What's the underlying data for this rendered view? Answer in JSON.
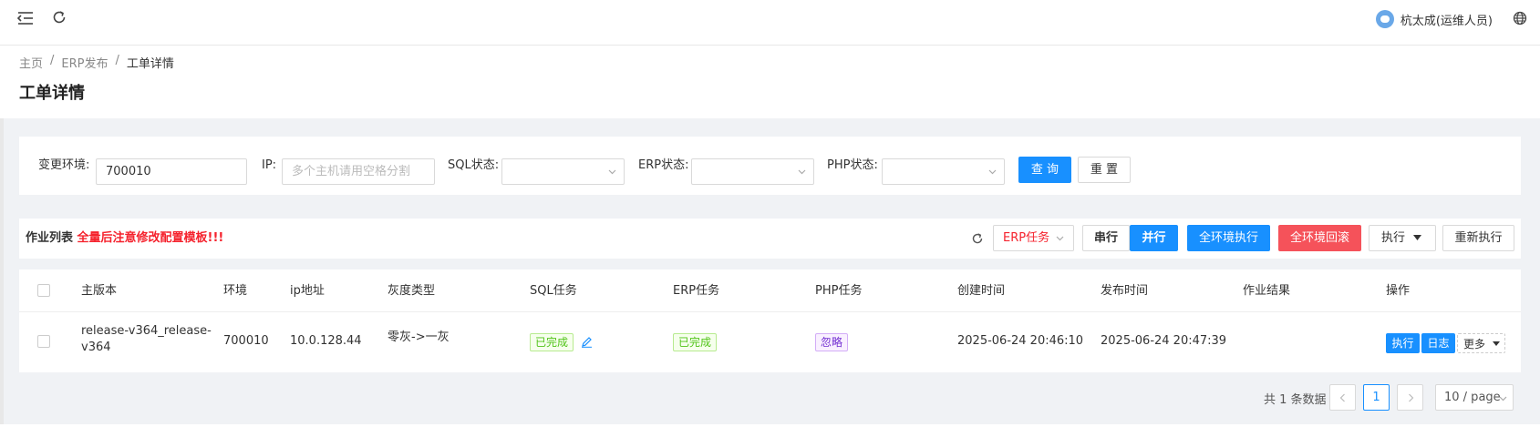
{
  "header": {
    "menu_icon": "menu-fold-icon",
    "refresh_icon": "reload-icon",
    "user_name": "杭太成(运维人员)",
    "globe_icon": "globe-icon"
  },
  "breadcrumb": {
    "items": [
      "主页",
      "ERP发布",
      "工单详情"
    ],
    "separator": "/"
  },
  "page_title": "工单详情",
  "filters": {
    "env_label": "变更环境:",
    "env_value": "700010",
    "ip_label": "IP:",
    "ip_placeholder": "多个主机请用空格分割",
    "sql_label": "SQL状态:",
    "sql_value": "",
    "erp_label": "ERP状态:",
    "erp_value": "",
    "php_label": "PHP状态:",
    "php_value": "",
    "query_button": "查 询",
    "reset_button": "重 置"
  },
  "job_list": {
    "label": "作业列表",
    "warning": "全量后注意修改配置模板!!!",
    "task_select": "ERP任务",
    "serial_button": "串行",
    "parallel_button": "并行",
    "exec_all_button": "全环境执行",
    "rollback_all_button": "全环境回滚",
    "exec_dropdown": "执行",
    "rerun_button": "重新执行"
  },
  "table": {
    "columns": [
      "主版本",
      "环境",
      "ip地址",
      "灰度类型",
      "SQL任务",
      "ERP任务",
      "PHP任务",
      "创建时间",
      "发布时间",
      "作业结果",
      "操作"
    ],
    "rows": [
      {
        "version_line1": "release-v364_release-",
        "version_line2": "v364",
        "env": "700010",
        "ip": "10.0.128.44",
        "gray_type": "零灰->一灰",
        "sql_task": "已完成",
        "erp_task": "已完成",
        "php_task": "忽略",
        "created": "2025-06-24 20:46:10",
        "published": "2025-06-24 20:47:39",
        "result": "",
        "action_exec": "执行",
        "action_log": "日志",
        "action_more": "更多"
      }
    ]
  },
  "pagination": {
    "total": "共 1 条数据",
    "current_page": "1",
    "page_size": "10 / page"
  },
  "colors": {
    "primary": "#1890ff",
    "danger": "#f5525a",
    "warning_text": "#f5222d",
    "success_tag": "#52c41a",
    "ignore_tag": "#722ed1"
  }
}
